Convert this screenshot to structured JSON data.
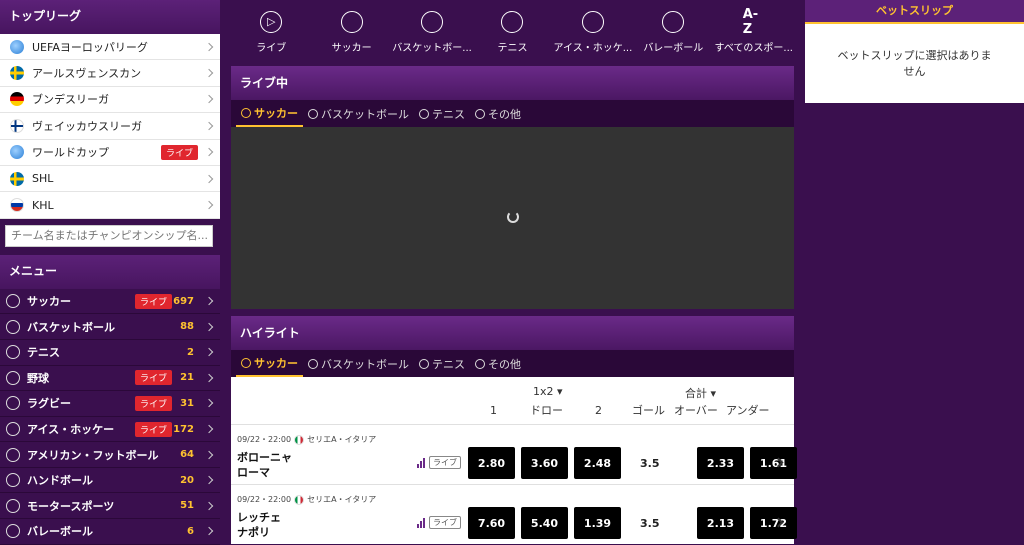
{
  "top_league": {
    "title": "トップリーグ",
    "items": [
      {
        "label": "UEFAヨーロッパリーグ",
        "flag": "globe",
        "live": ""
      },
      {
        "label": "アールスヴェンスカン",
        "flag": "se",
        "live": ""
      },
      {
        "label": "ブンデスリーガ",
        "flag": "de",
        "live": ""
      },
      {
        "label": "ヴェイッカウスリーガ",
        "flag": "fi",
        "live": ""
      },
      {
        "label": "ワールドカップ",
        "flag": "globe",
        "live": "ライブ"
      },
      {
        "label": "SHL",
        "flag": "se",
        "live": ""
      },
      {
        "label": "KHL",
        "flag": "ru",
        "live": ""
      }
    ],
    "search_placeholder": "チーム名またはチャンピオンシップ名..."
  },
  "menu": {
    "title": "メニュー",
    "items": [
      {
        "label": "サッカー",
        "live": "ライブ",
        "count": "697"
      },
      {
        "label": "バスケットボール",
        "live": "",
        "count": "88"
      },
      {
        "label": "テニス",
        "live": "",
        "count": "2"
      },
      {
        "label": "野球",
        "live": "ライブ",
        "count": "21"
      },
      {
        "label": "ラグビー",
        "live": "ライブ",
        "count": "31"
      },
      {
        "label": "アイス・ホッケー",
        "live": "ライブ",
        "count": "172"
      },
      {
        "label": "アメリカン・フットボール",
        "live": "",
        "count": "64"
      },
      {
        "label": "ハンドボール",
        "live": "",
        "count": "20"
      },
      {
        "label": "モータースポーツ",
        "live": "",
        "count": "51"
      },
      {
        "label": "バレーボール",
        "live": "",
        "count": "6"
      }
    ]
  },
  "sport_nav": [
    {
      "label": "ライブ",
      "icon": "play-icon",
      "glyph": "▷"
    },
    {
      "label": "サッカー",
      "icon": "soccer-ball-icon",
      "glyph": ""
    },
    {
      "label": "バスケットボー...",
      "icon": "basketball-icon",
      "glyph": ""
    },
    {
      "label": "テニス",
      "icon": "tennis-ball-icon",
      "glyph": ""
    },
    {
      "label": "アイス・ホッケ...",
      "icon": "hockey-puck-icon",
      "glyph": ""
    },
    {
      "label": "バレーボール",
      "icon": "volleyball-icon",
      "glyph": ""
    },
    {
      "label": "すべてのスポー...",
      "icon": "a-z-icon",
      "glyph": "A-Z"
    }
  ],
  "live_section": {
    "title": "ライブ中",
    "tabs": [
      "サッカー",
      "バスケットボール",
      "テニス",
      "その他"
    ]
  },
  "highlight_section": {
    "title": "ハイライト",
    "tabs": [
      "サッカー",
      "バスケットボール",
      "テニス",
      "その他"
    ],
    "group_1x2": "1x2 ▾",
    "group_total": "合計 ▾",
    "col_1": "1",
    "col_draw": "ドロー",
    "col_2": "2",
    "col_goal": "ゴール",
    "col_over": "オーバー",
    "col_under": "アンダー",
    "matches": [
      {
        "time": "09/22・22:00",
        "league": "セリエA・イタリア",
        "home": "ボローニャ",
        "away": "ローマ",
        "live": "ライブ",
        "o1": "2.80",
        "ox": "3.60",
        "o2": "2.48",
        "line": "3.5",
        "over": "2.33",
        "under": "1.61"
      },
      {
        "time": "09/22・22:00",
        "league": "セリエA・イタリア",
        "home": "レッチェ",
        "away": "ナポリ",
        "live": "ライブ",
        "o1": "7.60",
        "ox": "5.40",
        "o2": "1.39",
        "line": "3.5",
        "over": "2.13",
        "under": "1.72"
      }
    ]
  },
  "betslip": {
    "title": "ベットスリップ",
    "empty": "ベットスリップに選択はありません"
  },
  "colors": {
    "accent": "#ffc230",
    "live": "#e0262e",
    "bg": "#3a0f4e"
  }
}
